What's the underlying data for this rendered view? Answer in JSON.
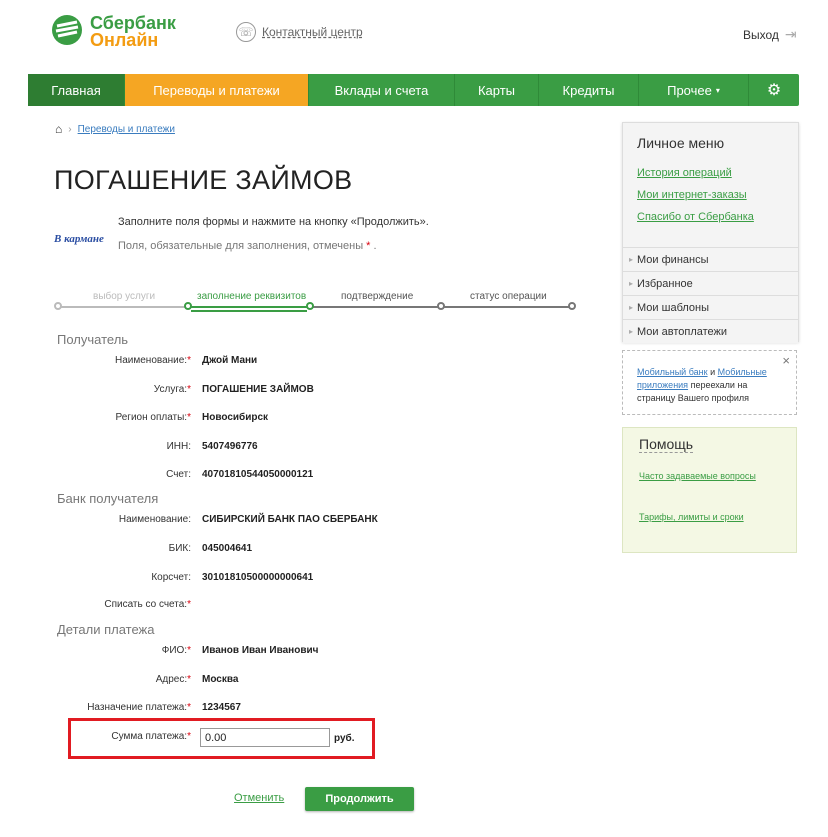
{
  "header": {
    "logo_line1": "Сбербанк",
    "logo_line2": "Онлайн",
    "contact_label": "Контактный центр",
    "logout_label": "Выход",
    "contact_icon": "phone-icon",
    "logout_icon": "logout-icon"
  },
  "nav": {
    "items": [
      "Главная",
      "Переводы и платежи",
      "Вклады и счета",
      "Карты",
      "Кредиты",
      "Прочее"
    ],
    "more_arrow": "▾",
    "gear_icon": "gear-icon",
    "active_color": "#f5a623",
    "brand_color": "#3a9d44"
  },
  "breadcrumb": {
    "home_icon": "home-icon",
    "link": "Переводы и платежи"
  },
  "page": {
    "title": "ПОГАШЕНИЕ ЗАЙМОВ",
    "provider_logo": "В кармане",
    "intro_line1": "Заполните поля формы и нажмите на кнопку «Продолжить».",
    "intro_line2": "Поля, обязательные для заполнения, отмечены",
    "required_mark": "*"
  },
  "steps": [
    {
      "label": "выбор услуги",
      "state": "done"
    },
    {
      "label": "заполнение реквизитов",
      "state": "current"
    },
    {
      "label": "подтверждение",
      "state": "next"
    },
    {
      "label": "статус операции",
      "state": "next"
    }
  ],
  "form": {
    "recipient": {
      "title": "Получатель",
      "name_label": "Наименование:",
      "name_value": "Джой Мани",
      "service_label": "Услуга:",
      "service_value": "ПОГАШЕНИЕ ЗАЙМОВ",
      "region_label": "Регион оплаты:",
      "region_value": "Новосибирск",
      "inn_label": "ИНН:",
      "inn_value": "5407496776",
      "account_label": "Счет:",
      "account_value": "40701810544050000121"
    },
    "bank": {
      "title": "Банк получателя",
      "name_label": "Наименование:",
      "name_value": "СИБИРСКИЙ БАНК ПАО СБЕРБАНК",
      "bik_label": "БИК:",
      "bik_value": "045004641",
      "corr_label": "Корсчет:",
      "corr_value": "30101810500000000641",
      "debit_label": "Списать со счета:"
    },
    "details": {
      "title": "Детали платежа",
      "fio_label": "ФИО:",
      "fio_value": "Иванов Иван Иванович",
      "address_label": "Адрес:",
      "address_value": "Москва",
      "purpose_label": "Назначение платежа:",
      "purpose_value": "1234567",
      "amount_label": "Сумма платежа:",
      "amount_value": "0.00",
      "amount_unit": "руб."
    },
    "cancel_label": "Отменить",
    "continue_label": "Продолжить"
  },
  "sidebar": {
    "menu_title": "Личное меню",
    "links": [
      "История операций",
      "Мои интернет-заказы",
      "Спасибо от Сбербанка"
    ],
    "items": [
      "Мои финансы",
      "Избранное",
      "Мои шаблоны",
      "Мои автоплатежи"
    ],
    "notice_link1": "Мобильный банк",
    "notice_and": "и",
    "notice_link2": "Мобильные приложения",
    "notice_rest": "переехали на страницу Вашего профиля",
    "notice_close": "×",
    "help_title": "Помощь",
    "help_links": [
      "Часто задаваемые вопросы",
      "Тарифы, лимиты и сроки"
    ]
  }
}
